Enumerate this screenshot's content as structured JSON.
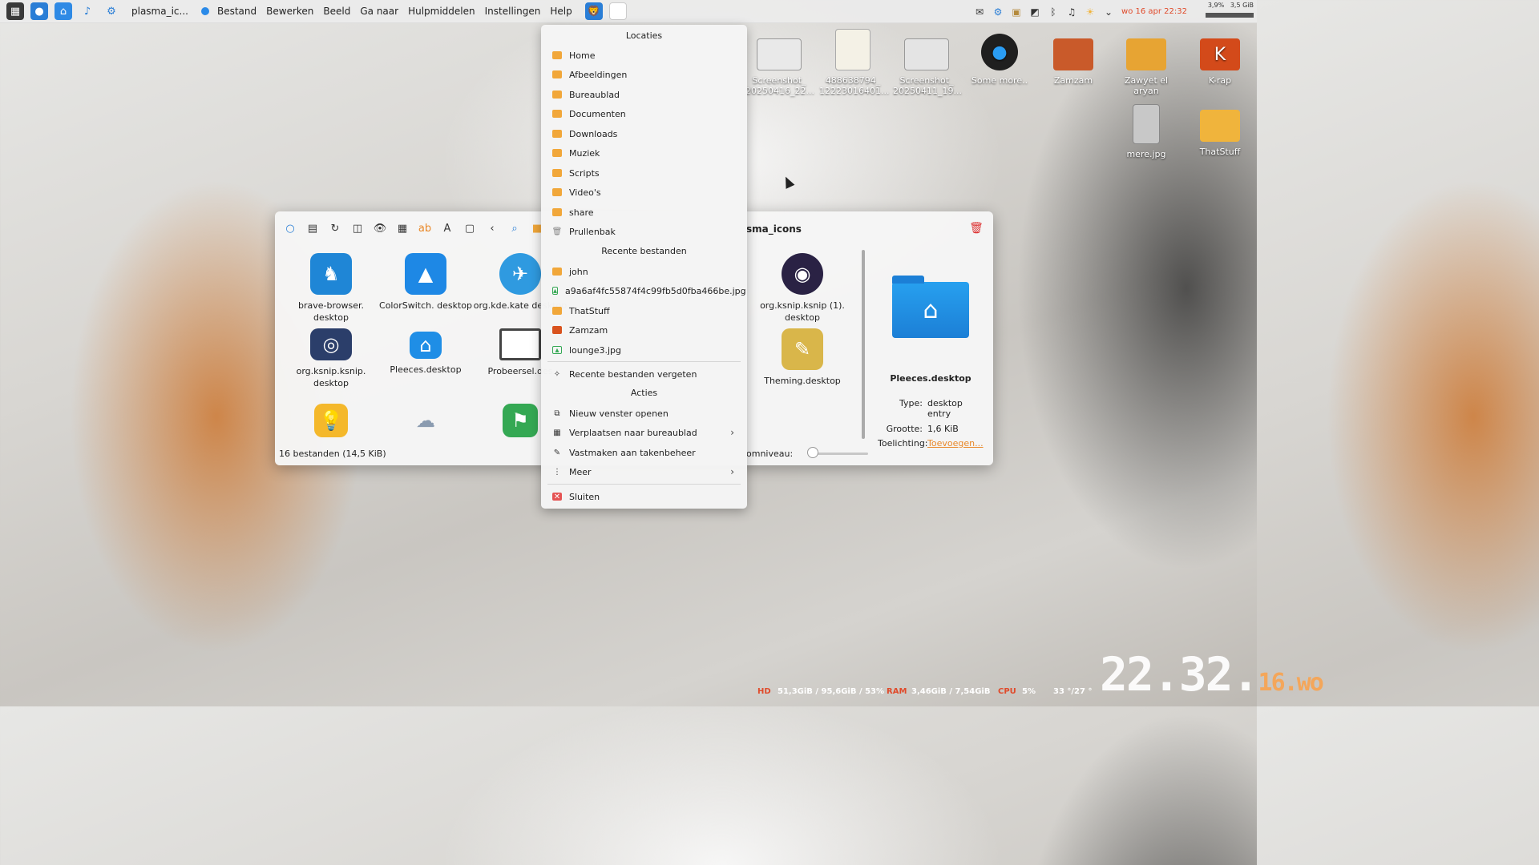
{
  "topbar": {
    "app_title": "plasma_ic...",
    "menus": [
      "Bestand",
      "Bewerken",
      "Beeld",
      "Ga naar",
      "Hulpmiddelen",
      "Instellingen",
      "Help"
    ],
    "clock": "wo 16 apr 22:32",
    "stats_top": "3,9%",
    "stats_right": "3,5 GiB"
  },
  "desktop_icons": [
    {
      "label": "Screenshot_ 20250416_22...",
      "color": "#e9e9e9"
    },
    {
      "label": "488638794_ 12223016401...",
      "color": "#f4f1e6"
    },
    {
      "label": "Screenshot_ 20250411_19...",
      "color": "#e4e4e4"
    },
    {
      "label": "Some more..",
      "color": "#1f1f1f"
    },
    {
      "label": "Zamzam",
      "color": "#c95a2a"
    },
    {
      "label": "Zawyet el aryan",
      "color": "#e7a433"
    },
    {
      "label": "K-rap",
      "color": "#d34a1a"
    },
    {
      "label": "mere.jpg",
      "color": "#c8c8c8"
    },
    {
      "label": "ThatStuff",
      "color": "#f0b43c"
    }
  ],
  "window": {
    "title": "sma_icons",
    "status": "16 bestanden (14,5 KiB)",
    "zoom_label": "omniveau:",
    "files": [
      {
        "label": "brave-browser. desktop",
        "icon": "lion-icon",
        "color": "#1f86d6"
      },
      {
        "label": "ColorSwitch. desktop",
        "icon": "mountain-icon",
        "color": "#1e88e5"
      },
      {
        "label": "org.kde.kate desktop",
        "icon": "bird-icon",
        "color": "#2f9ae0"
      },
      {
        "label": "org.ksnip.ksnip (1). desktop",
        "icon": "lens-icon",
        "color": "#2a2244"
      },
      {
        "label": "org.ksnip.ksnip. desktop",
        "icon": "camera-icon",
        "color": "#2b3e6a"
      },
      {
        "label": "Pleeces.desktop",
        "icon": "home-folder-icon",
        "color": "#1f8ee6"
      },
      {
        "label": "Probeersel.des",
        "icon": "laptop-icon",
        "color": "#444444"
      },
      {
        "label": "Theming.desktop",
        "icon": "brush-icon",
        "color": "#d9b64a"
      },
      {
        "label": "",
        "icon": "bulb-icon",
        "color": "#f4b82b"
      },
      {
        "label": "",
        "icon": "weather-icon",
        "color": "#e8d24a"
      },
      {
        "label": "",
        "icon": "maps-icon",
        "color": "#34a853"
      }
    ],
    "info": {
      "name": "Pleeces.desktop",
      "type_key": "Type:",
      "type_val": "desktop entry",
      "size_key": "Grootte:",
      "size_val": "1,6 KiB",
      "note_key": "Toelichting:",
      "note_val": "Toevoegen..."
    }
  },
  "popup": {
    "locations_header": "Locaties",
    "locations": [
      {
        "label": "Home",
        "kind": "folder"
      },
      {
        "label": "Afbeeldingen",
        "kind": "folder"
      },
      {
        "label": "Bureaublad",
        "kind": "folder"
      },
      {
        "label": "Documenten",
        "kind": "folder"
      },
      {
        "label": "Downloads",
        "kind": "folder"
      },
      {
        "label": "Muziek",
        "kind": "folder"
      },
      {
        "label": "Scripts",
        "kind": "folder"
      },
      {
        "label": "Video's",
        "kind": "folder"
      },
      {
        "label": "share",
        "kind": "folder"
      },
      {
        "label": "Prullenbak",
        "kind": "trash"
      }
    ],
    "recent_header": "Recente bestanden",
    "recent": [
      {
        "label": "john",
        "kind": "folder"
      },
      {
        "label": "a9a6af4fc55874f4c99fb5d0fba466be.jpg",
        "kind": "image"
      },
      {
        "label": "ThatStuff",
        "kind": "folder"
      },
      {
        "label": "Zamzam",
        "kind": "folder-red"
      },
      {
        "label": "lounge3.jpg",
        "kind": "image"
      }
    ],
    "forget_recent": "Recente bestanden vergeten",
    "actions_header": "Acties",
    "actions": [
      {
        "label": "Nieuw venster openen",
        "sym": "⧉",
        "submenu": false
      },
      {
        "label": "Verplaatsen naar bureaublad",
        "sym": "▦",
        "submenu": true
      },
      {
        "label": "Vastmaken aan takenbeheer",
        "sym": "✎",
        "submenu": false
      },
      {
        "label": "Meer",
        "sym": "⋮",
        "submenu": true
      }
    ],
    "close": "Sluiten"
  },
  "bottom": {
    "hd_label": "HD",
    "hd_val": "51,3GiB / 95,6GiB / 53%",
    "ram_label": "RAM",
    "ram_val": "3,46GiB / 7,54GiB",
    "cpu_label": "CPU",
    "cpu_val": "5%",
    "temp_val": "33 °/27 °",
    "clock_main": "22.32.",
    "clock_day": "16.",
    "clock_wd": "wo",
    "accent": "#e04a2a"
  }
}
